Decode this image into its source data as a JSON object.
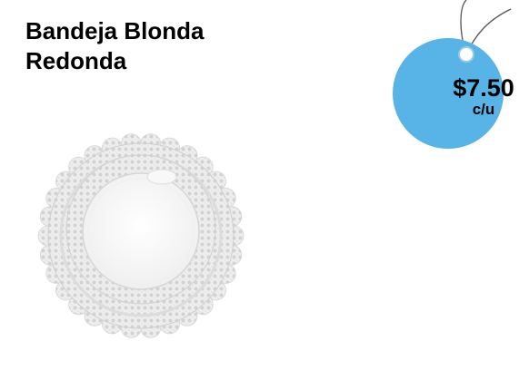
{
  "product": {
    "title_line1": "Bandeja Blonda",
    "title_line2": "Redonda",
    "image_icon": "lace-doily-plate"
  },
  "price_tag": {
    "amount": "$7.50",
    "unit": "c/u",
    "color": "#58b4e6"
  }
}
